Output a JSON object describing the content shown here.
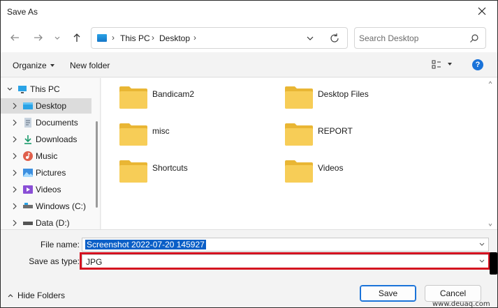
{
  "window": {
    "title": "Save As",
    "close_icon": "close-icon"
  },
  "address": {
    "crumbs": [
      "This PC",
      "Desktop"
    ],
    "search_placeholder": "Search Desktop"
  },
  "toolbar": {
    "organize": "Organize",
    "new_folder": "New folder",
    "help": "?"
  },
  "nav": {
    "items": [
      {
        "label": "This PC",
        "icon": "this-pc-icon",
        "expanded": true
      },
      {
        "label": "Desktop",
        "icon": "desktop-icon",
        "selected": true
      },
      {
        "label": "Documents",
        "icon": "documents-icon"
      },
      {
        "label": "Downloads",
        "icon": "downloads-icon"
      },
      {
        "label": "Music",
        "icon": "music-icon"
      },
      {
        "label": "Pictures",
        "icon": "pictures-icon"
      },
      {
        "label": "Videos",
        "icon": "videos-icon"
      },
      {
        "label": "Windows (C:)",
        "icon": "drive-icon"
      },
      {
        "label": "Data (D:)",
        "icon": "drive-icon"
      }
    ]
  },
  "folders": [
    {
      "name": "Bandicam2"
    },
    {
      "name": "Desktop Files"
    },
    {
      "name": "misc"
    },
    {
      "name": "REPORT"
    },
    {
      "name": "Shortcuts"
    },
    {
      "name": "Videos"
    }
  ],
  "form": {
    "file_name_label": "File name:",
    "file_name_value": "Screenshot 2022-07-20 145927",
    "type_label": "Save as type:",
    "type_value": "JPG"
  },
  "footer": {
    "hide_folders": "Hide Folders",
    "save": "Save",
    "cancel": "Cancel",
    "watermark": "www.deuaq.com"
  },
  "colors": {
    "accent": "#1a73d9",
    "highlight": "#d4111f",
    "selection": "#0b5fc7",
    "folder": "#f4c54a"
  }
}
